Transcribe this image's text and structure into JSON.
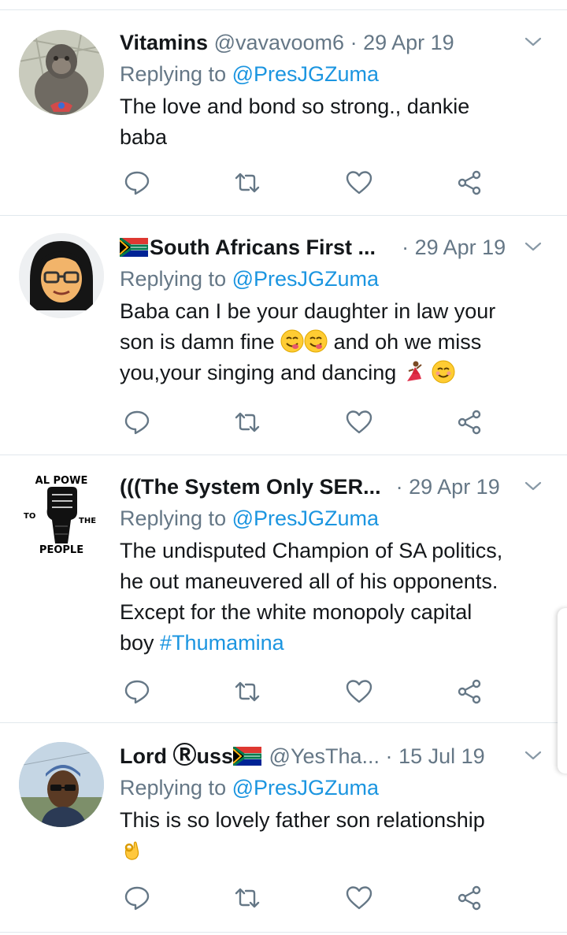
{
  "tweets": [
    {
      "name": "Vitamins",
      "handle": "@vavavoom6",
      "separator": "·",
      "date": "29 Apr 19",
      "replying_prefix": "Replying to ",
      "replying_to": "@PresJGZuma",
      "text_line1": "The love and bond so strong., dankie",
      "text_line2": "baba"
    },
    {
      "name": "South Africans First ...",
      "separator": "·",
      "date": "29 Apr 19",
      "replying_prefix": "Replying to ",
      "replying_to": "@PresJGZuma",
      "text_line1": "Baba can I be your daughter in law your",
      "text_line2": "son is damn fine ",
      "text_line2b": " and oh we miss",
      "text_line3": "you,your singing and dancing "
    },
    {
      "name": "(((The System Only SER...",
      "separator": "·",
      "date": "29 Apr 19",
      "replying_prefix": "Replying to ",
      "replying_to": "@PresJGZuma",
      "text_line1": "The undisputed Champion of SA politics,",
      "text_line2": "he out maneuvered all of his opponents.",
      "text_line3": "Except for the white monopoly capital",
      "text_line4": "boy ",
      "hashtag": "#Thumamina",
      "avatar_text_top": "AL POWE",
      "avatar_text_to": "TO",
      "avatar_text_the": "THE",
      "avatar_text_people": "PEOPLE"
    },
    {
      "name_part1": "Lord ",
      "name_symbol": "Ⓡ",
      "name_part2": "uss",
      "handle": "@YesTha...",
      "separator": "·",
      "date": "15 Jul 19",
      "replying_prefix": "Replying to ",
      "replying_to": "@PresJGZuma",
      "text_line1": "This is so lovely father son relationship"
    }
  ],
  "icons": {
    "reply": "reply-icon",
    "retweet": "retweet-icon",
    "like": "like-icon",
    "share": "share-icon",
    "caret": "chevron-down-icon"
  },
  "colors": {
    "link": "#1b95e0",
    "muted": "#657786",
    "text": "#14171a",
    "divider": "#e1e8ed"
  }
}
